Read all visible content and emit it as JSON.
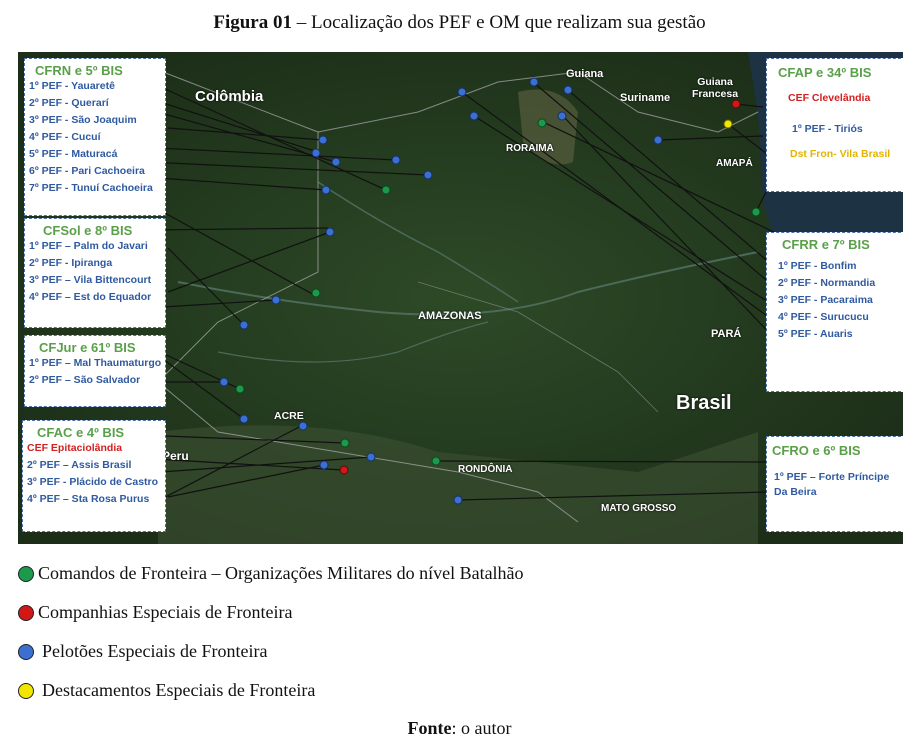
{
  "caption": {
    "figure": "Figura 01",
    "title": " – Localização dos PEF e OM que realizam sua gestão"
  },
  "geo_labels": {
    "colombia": "Colômbia",
    "guiana": "Guiana",
    "suriname": "Suriname",
    "guiana_francesa": "Guiana Francesa",
    "roraima": "RORAIMA",
    "amapa": "AMAPÁ",
    "amazonas": "AMAZONAS",
    "para": "PARÁ",
    "brasil": "Brasil",
    "acre": "ACRE",
    "peru": "Peru",
    "rondonia": "RONDÔNIA",
    "mato_grosso": "MATO GROSSO"
  },
  "boxes": {
    "cfrn": {
      "title": "CFRN e 5º BIS",
      "items": [
        "1º PEF - Yauaretê",
        "2º PEF - Querarí",
        "3º PEF - São Joaquim",
        "4º PEF - Cucuí",
        "5º PEF - Maturacá",
        "6º PEF - Pari Cachoeira",
        "7º PEF - Tunuí Cachoeira"
      ]
    },
    "cfsol": {
      "title": "CFSol e 8º BIS",
      "items": [
        "1º PEF – Palm do Javari",
        "2º PEF - Ipiranga",
        "3º PEF – Vila Bittencourt",
        "4º PEF – Est do Equador"
      ]
    },
    "cfjur": {
      "title": "CFJur e 61º BIS",
      "items": [
        "1º PEF – Mal Thaumaturgo",
        "2º PEF – São Salvador"
      ]
    },
    "cfac": {
      "title": "CFAC e 4º BIS",
      "items": [
        "CEF Epitaciolândia",
        "2º PEF – Assis Brasil",
        "3º PEF - Plácido de Castro",
        "4º PEF – Sta Rosa Purus"
      ]
    },
    "cfap": {
      "title": "CFAP e 34º BIS",
      "items": [
        "CEF Clevelândia",
        "1º PEF - Tiriós",
        "Dst Fron- Vila Brasil"
      ]
    },
    "cfrr": {
      "title": "CFRR e 7º BIS",
      "items": [
        "1º PEF - Bonfim",
        "2º PEF - Normandia",
        "3º PEF - Pacaraima",
        "4º PEF - Surucucu",
        "5º PEF - Auaris"
      ]
    },
    "cfro": {
      "title": "CFRO e 6º BIS",
      "items": [
        "1º PEF – Forte Príncipe Da Beira"
      ]
    }
  },
  "legend": [
    {
      "color": "#1a9a4a",
      "label": "Comandos de Fronteira – Organizações Militares do nível Batalhão"
    },
    {
      "color": "#d01818",
      "label": "Companhias Especiais de Fronteira"
    },
    {
      "color": "#3b6fd0",
      "label": "Pelotões Especiais de Fronteira"
    },
    {
      "color": "#f2e600",
      "label": "Destacamentos Especiais de Fronteira"
    }
  ],
  "source": {
    "label": "Fonte",
    "text": ": o autor"
  },
  "colors": {
    "command": "#1a9a4a",
    "company": "#d01818",
    "platoon": "#3b6fd0",
    "detachment": "#f2e600"
  }
}
